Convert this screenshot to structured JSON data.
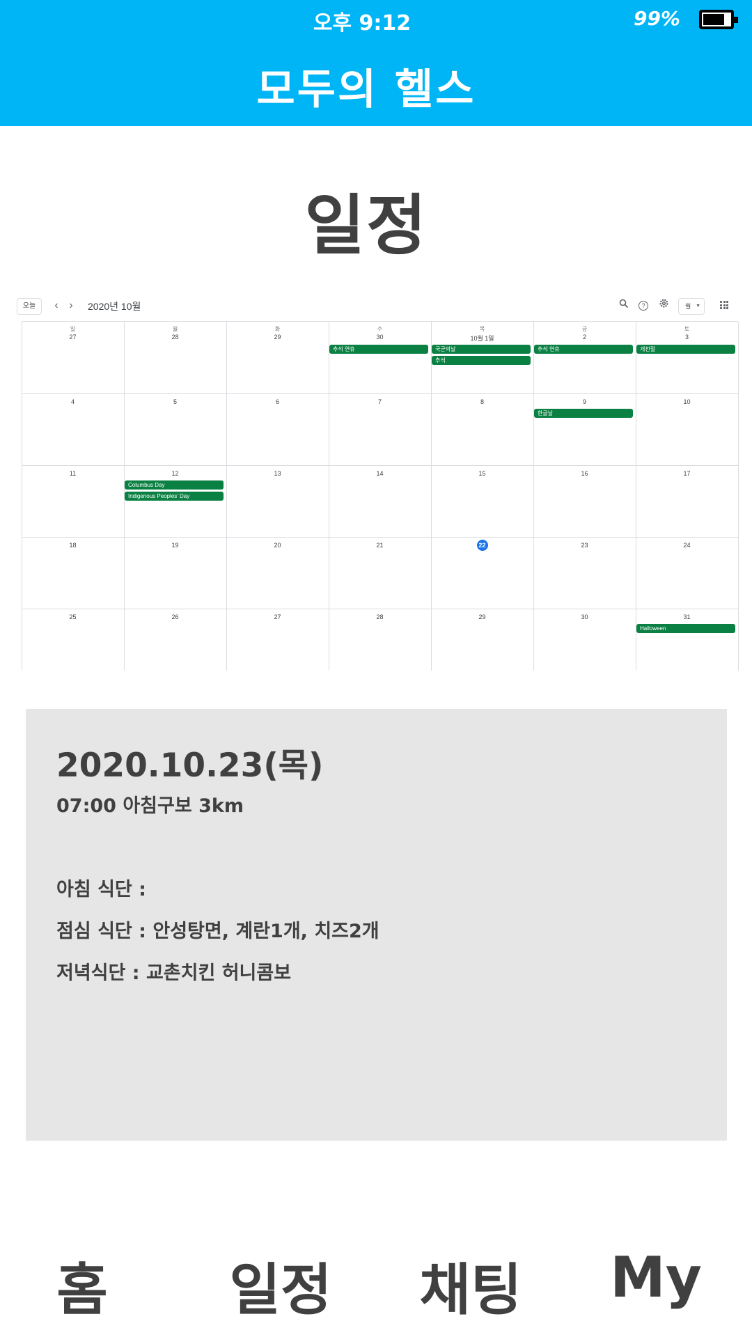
{
  "status_bar": {
    "time": "오후 9:12",
    "battery": "99%"
  },
  "header": {
    "title": "모두의 헬스"
  },
  "page": {
    "title": "일정"
  },
  "calendar": {
    "today_label": "오늘",
    "prev_icon": "chevron-left-icon",
    "next_icon": "chevron-right-icon",
    "month_label": "2020년 10월",
    "view_label": "월",
    "weekdays": [
      "일",
      "월",
      "화",
      "수",
      "목",
      "금",
      "토"
    ],
    "weeks": [
      [
        "27",
        "28",
        "29",
        "30",
        "10월 1일",
        "2",
        "3"
      ],
      [
        "4",
        "5",
        "6",
        "7",
        "8",
        "9",
        "10"
      ],
      [
        "11",
        "12",
        "13",
        "14",
        "15",
        "16",
        "17"
      ],
      [
        "18",
        "19",
        "20",
        "21",
        "22",
        "23",
        "24"
      ],
      [
        "25",
        "26",
        "27",
        "28",
        "29",
        "30",
        "31"
      ]
    ],
    "today_number": "22",
    "events": [
      {
        "title": "추석 연휴",
        "week": 0,
        "day": 3,
        "slot": 0
      },
      {
        "title": "국군의날",
        "week": 0,
        "day": 4,
        "slot": 0
      },
      {
        "title": "추석",
        "week": 0,
        "day": 4,
        "slot": 1
      },
      {
        "title": "추석 연휴",
        "week": 0,
        "day": 5,
        "slot": 0
      },
      {
        "title": "개천절",
        "week": 0,
        "day": 6,
        "slot": 0
      },
      {
        "title": "한글날",
        "week": 1,
        "day": 5,
        "slot": 0
      },
      {
        "title": "Columbus Day",
        "week": 2,
        "day": 1,
        "slot": 0
      },
      {
        "title": "Indigenous Peoples' Day",
        "week": 2,
        "day": 1,
        "slot": 1
      },
      {
        "title": "Halloween",
        "week": 4,
        "day": 6,
        "slot": 0
      }
    ],
    "event_color": "#0b8043",
    "today_color": "#1a73e8"
  },
  "detail": {
    "date": "2020.10.23(목)",
    "workout": "07:00 아침구보 3km",
    "breakfast": "아침 식단 :",
    "lunch": "점심 식단 : 안성탕면, 계란1개, 치즈2개",
    "dinner": "저녁식단 : 교촌치킨 허니콤보"
  },
  "bottom_nav": {
    "home": "홈",
    "schedule": "일정",
    "chat": "채팅",
    "my": "My"
  },
  "colors": {
    "header_bg": "#00b5f5",
    "card_bg": "#e6e6e6",
    "text": "#404040"
  }
}
